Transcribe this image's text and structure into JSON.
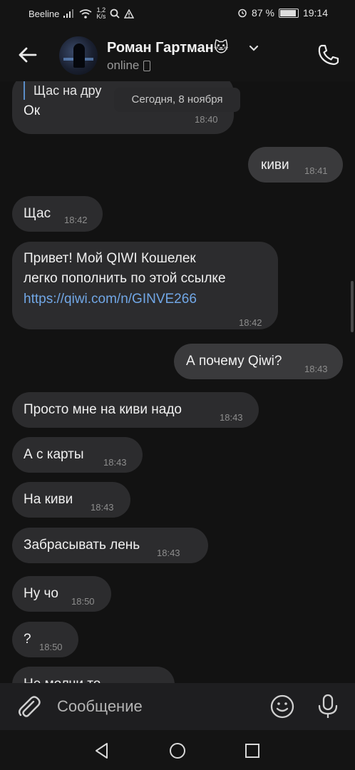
{
  "statusbar": {
    "carrier": "Beeline",
    "net_speed": "1,2",
    "net_speed_unit": "K/s",
    "battery": "87 %",
    "battery_level": 0.87,
    "time": "19:14"
  },
  "header": {
    "contact_name": "Роман Гартман🐱",
    "status": "online"
  },
  "chat": {
    "date_separator": "Сегодня, 8 ноября",
    "messages": [
      {
        "quote": "Щас на дру",
        "text": "Ок",
        "time": "18:40",
        "direction": "in"
      },
      {
        "text": "киви",
        "time": "18:41",
        "direction": "out"
      },
      {
        "text": "Щас",
        "time": "18:42",
        "direction": "in"
      },
      {
        "text_line1": "Привет! Мой QIWI Кошелек",
        "text_line2": "легко пополнить по этой ссылке",
        "link": "https://qiwi.com/n/GINVE266",
        "time": "18:42",
        "direction": "in"
      },
      {
        "text": "А почему Qiwi?",
        "time": "18:43",
        "direction": "out"
      },
      {
        "text": "Просто мне на киви надо",
        "time": "18:43",
        "direction": "in"
      },
      {
        "text": "А с карты",
        "time": "18:43",
        "direction": "in"
      },
      {
        "text": "На киви",
        "time": "18:43",
        "direction": "in"
      },
      {
        "text": "Забрасывать лень",
        "time": "18:43",
        "direction": "in"
      },
      {
        "text": "Ну чо",
        "time": "18:50",
        "direction": "in"
      },
      {
        "text": "?",
        "time": "18:50",
        "direction": "in"
      },
      {
        "text": "Не молчи то",
        "time": "",
        "direction": "in"
      }
    ]
  },
  "composer": {
    "placeholder": "Сообщение"
  },
  "colors": {
    "background": "#121212",
    "bubble": "#2c2c2e",
    "link": "#71a7e6",
    "quote_bar": "#5b8dc7"
  }
}
